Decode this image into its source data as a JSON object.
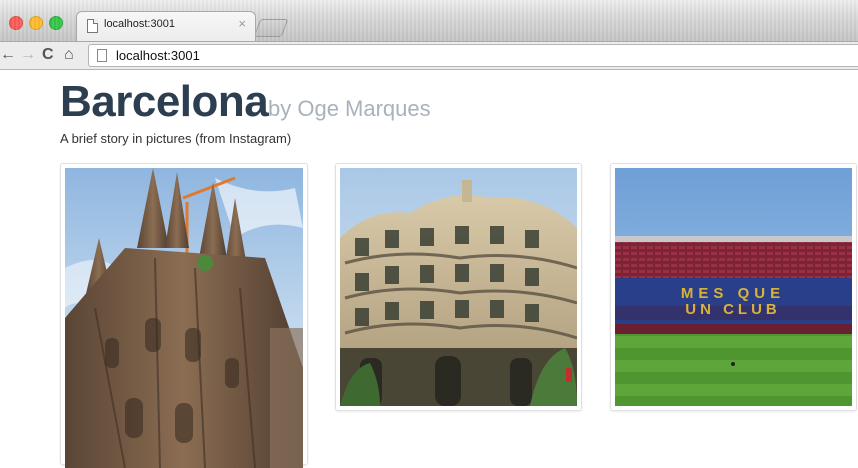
{
  "browser": {
    "tab_title": "localhost:3001",
    "tab_close": "×",
    "address": "localhost:3001",
    "nav": {
      "back": "←",
      "forward": "→",
      "reload": "C",
      "home": "⌂"
    }
  },
  "page": {
    "title": "Barcelona",
    "author": "by Oge Marques",
    "subtitle": "A brief story in pictures (from Instagram)",
    "title_color": "#2c3e50",
    "author_color": "#a9b1bb"
  },
  "photos": {
    "stadium_sign_line1": "MES QUE",
    "stadium_sign_line2": "UN CLUB"
  }
}
